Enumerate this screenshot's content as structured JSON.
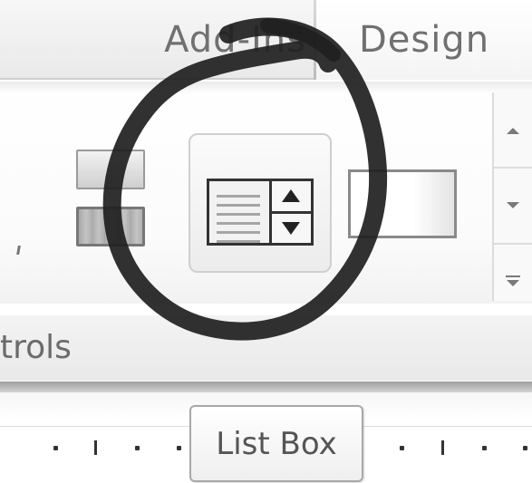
{
  "ribbon": {
    "tabs": [
      {
        "label": "Add-Ins",
        "active": false
      },
      {
        "label": "Design",
        "active": true
      }
    ],
    "group_label": "trols",
    "controls": [
      {
        "name": "button-control",
        "icon": "button-icon"
      },
      {
        "name": "toggle-control",
        "icon": "toggle-icon"
      },
      {
        "name": "list-box",
        "icon": "list-box-icon",
        "highlighted": true
      },
      {
        "name": "rectangle-control",
        "icon": "rectangle-icon"
      }
    ],
    "gallery_scroll": {
      "up_icon": "chevron-up-icon",
      "down_icon": "chevron-down-icon",
      "more_icon": "gallery-more-icon"
    }
  },
  "tooltip": {
    "text": "List Box"
  },
  "annotation": {
    "shape": "hand-drawn-circle",
    "color": "#1f1f1f"
  },
  "colors": {
    "tab_text": "#707070",
    "ribbon_bg": "#ffffff",
    "icon_dark": "#333333"
  }
}
